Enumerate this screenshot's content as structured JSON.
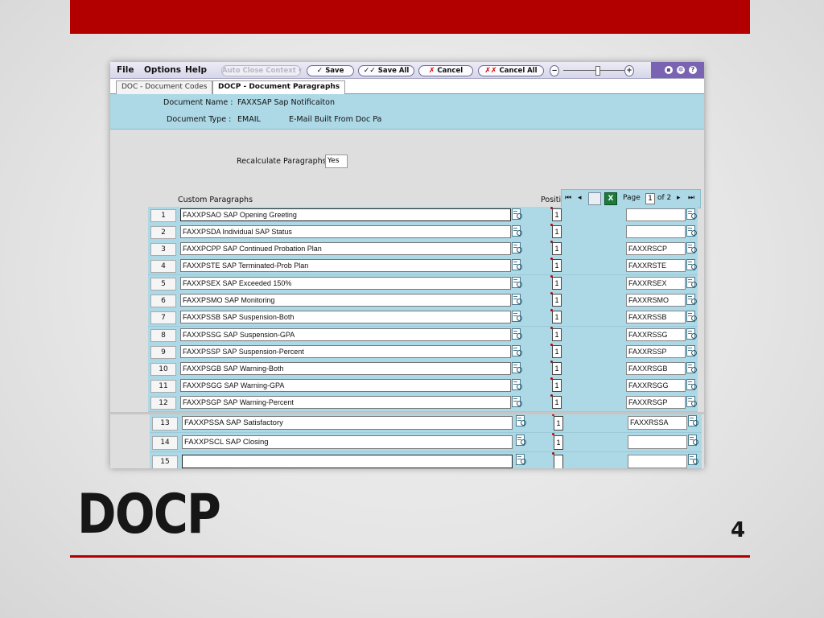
{
  "slide": {
    "title": "DOCP",
    "page_number": "4"
  },
  "menu": {
    "file": "File",
    "options": "Options",
    "help": "Help"
  },
  "toolbar": {
    "auto_close": "Auto Close Context",
    "save": "Save",
    "save_all": "Save All",
    "cancel": "Cancel",
    "cancel_all": "Cancel All"
  },
  "tabs": [
    {
      "label": "DOC - Document Codes"
    },
    {
      "label": "DOCP - Document Paragraphs"
    }
  ],
  "header": {
    "name_label": "Document Name :",
    "name_value": "FAXXSAP Sap Notificaiton",
    "type_label": "Document Type :",
    "type_value": "EMAIL",
    "type_desc": "E-Mail Built From Doc Pa"
  },
  "recalc": {
    "label": "Recalculate Paragraphs",
    "value": "Yes"
  },
  "columns": {
    "custom_paragraphs": "Custom Paragraphs",
    "position": "Positi"
  },
  "pager": {
    "page_label": "Page",
    "page": "1",
    "of_label": "of 2",
    "excel_icon": "X"
  },
  "rows": [
    {
      "num": "1",
      "para": "FAXXPSAO SAP Opening Greeting",
      "pos": "1",
      "code": ""
    },
    {
      "num": "2",
      "para": "FAXXPSDA Individual SAP Status",
      "pos": "1",
      "code": ""
    },
    {
      "num": "3",
      "para": "FAXXPCPP SAP Continued Probation Plan",
      "pos": "1",
      "code": "FAXXRSCP"
    },
    {
      "num": "4",
      "para": "FAXXPSTE SAP Terminated-Prob Plan",
      "pos": "1",
      "code": "FAXXRSTE"
    },
    {
      "num": "5",
      "para": "FAXXPSEX SAP Exceeded 150%",
      "pos": "1",
      "code": "FAXXRSEX"
    },
    {
      "num": "6",
      "para": "FAXXPSMO SAP Monitoring",
      "pos": "1",
      "code": "FAXXRSMO"
    },
    {
      "num": "7",
      "para": "FAXXPSSB SAP Suspension-Both",
      "pos": "1",
      "code": "FAXXRSSB"
    },
    {
      "num": "8",
      "para": "FAXXPSSG SAP Suspension-GPA",
      "pos": "1",
      "code": "FAXXRSSG"
    },
    {
      "num": "9",
      "para": "FAXXPSSP SAP Suspension-Percent",
      "pos": "1",
      "code": "FAXXRSSP"
    },
    {
      "num": "10",
      "para": "FAXXPSGB SAP Warning-Both",
      "pos": "1",
      "code": "FAXXRSGB"
    },
    {
      "num": "11",
      "para": "FAXXPSGG SAP Warning-GPA",
      "pos": "1",
      "code": "FAXXRSGG"
    },
    {
      "num": "12",
      "para": "FAXXPSGP SAP Warning-Percent",
      "pos": "1",
      "code": "FAXXRSGP"
    },
    {
      "num": "13",
      "para": "FAXXPSSA SAP Satisfactory",
      "pos": "1",
      "code": "FAXXRSSA"
    },
    {
      "num": "14",
      "para": "FAXXPSCL SAP Closing",
      "pos": "1",
      "code": ""
    },
    {
      "num": "15",
      "para": "",
      "pos": "",
      "code": ""
    }
  ]
}
